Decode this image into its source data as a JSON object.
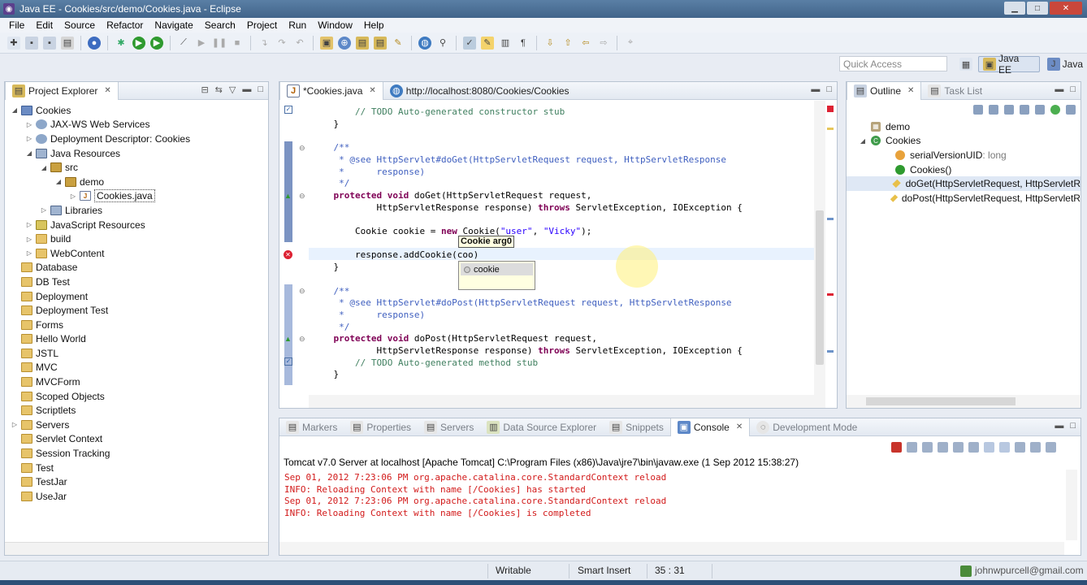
{
  "window": {
    "title": "Java EE - Cookies/src/demo/Cookies.java - Eclipse"
  },
  "menu": [
    "File",
    "Edit",
    "Source",
    "Refactor",
    "Navigate",
    "Search",
    "Project",
    "Run",
    "Window",
    "Help"
  ],
  "toolbar": {
    "quick_access_placeholder": "Quick Access"
  },
  "perspectives": [
    {
      "label": "Java EE",
      "active": true
    },
    {
      "label": "Java",
      "active": false
    }
  ],
  "project_explorer": {
    "title": "Project Explorer",
    "items": [
      {
        "label": "Cookies",
        "level": 0,
        "arrow": "open",
        "icon": "project"
      },
      {
        "label": "JAX-WS Web Services",
        "level": 1,
        "arrow": "closed",
        "icon": "gear"
      },
      {
        "label": "Deployment Descriptor: Cookies",
        "level": 1,
        "arrow": "closed",
        "icon": "gear"
      },
      {
        "label": "Java Resources",
        "level": 1,
        "arrow": "open",
        "icon": "lib"
      },
      {
        "label": "src",
        "level": 2,
        "arrow": "open",
        "icon": "pkg"
      },
      {
        "label": "demo",
        "level": 3,
        "arrow": "open",
        "icon": "pkg"
      },
      {
        "label": "Cookies.java",
        "level": 4,
        "arrow": "closed",
        "icon": "file",
        "selected": true
      },
      {
        "label": "Libraries",
        "level": 2,
        "arrow": "closed",
        "icon": "lib"
      },
      {
        "label": "JavaScript Resources",
        "level": 1,
        "arrow": "closed",
        "icon": "js"
      },
      {
        "label": "build",
        "level": 1,
        "arrow": "closed",
        "icon": "folder"
      },
      {
        "label": "WebContent",
        "level": 1,
        "arrow": "closed",
        "icon": "folder"
      },
      {
        "label": "Database",
        "level": 0,
        "arrow": "",
        "icon": "folder"
      },
      {
        "label": "DB Test",
        "level": 0,
        "arrow": "",
        "icon": "folder"
      },
      {
        "label": "Deployment",
        "level": 0,
        "arrow": "",
        "icon": "folder"
      },
      {
        "label": "Deployment Test",
        "level": 0,
        "arrow": "",
        "icon": "folder"
      },
      {
        "label": "Forms",
        "level": 0,
        "arrow": "",
        "icon": "folder"
      },
      {
        "label": "Hello World",
        "level": 0,
        "arrow": "",
        "icon": "folder"
      },
      {
        "label": "JSTL",
        "level": 0,
        "arrow": "",
        "icon": "folder"
      },
      {
        "label": "MVC",
        "level": 0,
        "arrow": "",
        "icon": "folder"
      },
      {
        "label": "MVCForm",
        "level": 0,
        "arrow": "",
        "icon": "folder"
      },
      {
        "label": "Scoped Objects",
        "level": 0,
        "arrow": "",
        "icon": "folder"
      },
      {
        "label": "Scriptlets",
        "level": 0,
        "arrow": "",
        "icon": "folder"
      },
      {
        "label": "Servers",
        "level": 0,
        "arrow": "closed",
        "icon": "folder"
      },
      {
        "label": "Servlet Context",
        "level": 0,
        "arrow": "",
        "icon": "folder"
      },
      {
        "label": "Session Tracking",
        "level": 0,
        "arrow": "",
        "icon": "folder"
      },
      {
        "label": "Test",
        "level": 0,
        "arrow": "",
        "icon": "folder"
      },
      {
        "label": "TestJar",
        "level": 0,
        "arrow": "",
        "icon": "folder"
      },
      {
        "label": "UseJar",
        "level": 0,
        "arrow": "",
        "icon": "folder"
      }
    ]
  },
  "editor": {
    "tabs": [
      {
        "label": "*Cookies.java",
        "active": true
      },
      {
        "label": "http://localhost:8080/Cookies/Cookies",
        "active": false
      }
    ],
    "code_lines": [
      [
        {
          "t": "        ",
          "c": ""
        },
        {
          "t": "// TODO Auto-generated constructor stub",
          "c": "cm"
        }
      ],
      [
        {
          "t": "    }",
          "c": ""
        }
      ],
      [
        {
          "t": "",
          "c": ""
        }
      ],
      [
        {
          "t": "    /**",
          "c": "jd"
        }
      ],
      [
        {
          "t": "     * @see HttpServlet#doGet(HttpServletRequest request, HttpServletResponse",
          "c": "jd"
        }
      ],
      [
        {
          "t": "     *      response)",
          "c": "jd"
        }
      ],
      [
        {
          "t": "     */",
          "c": "jd"
        }
      ],
      [
        {
          "t": "    ",
          "c": ""
        },
        {
          "t": "protected void",
          "c": "kw"
        },
        {
          "t": " doGet(HttpServletRequest request,",
          "c": ""
        }
      ],
      [
        {
          "t": "            HttpServletResponse response) ",
          "c": ""
        },
        {
          "t": "throws",
          "c": "kw"
        },
        {
          "t": " ServletException, IOException {",
          "c": ""
        }
      ],
      [
        {
          "t": "",
          "c": ""
        }
      ],
      [
        {
          "t": "        Cookie cookie = ",
          "c": ""
        },
        {
          "t": "new",
          "c": "kw"
        },
        {
          "t": " Cookie(",
          "c": ""
        },
        {
          "t": "\"user\"",
          "c": "str"
        },
        {
          "t": ", ",
          "c": ""
        },
        {
          "t": "\"Vicky\"",
          "c": "str"
        },
        {
          "t": ");",
          "c": ""
        }
      ],
      [
        {
          "t": "",
          "c": ""
        }
      ],
      [
        {
          "t": "        response.addCookie(coo)",
          "c": ""
        }
      ],
      [
        {
          "t": "    }",
          "c": ""
        }
      ],
      [
        {
          "t": "",
          "c": ""
        }
      ],
      [
        {
          "t": "    /**",
          "c": "jd"
        }
      ],
      [
        {
          "t": "     * @see HttpServlet#doPost(HttpServletRequest request, HttpServletResponse",
          "c": "jd"
        }
      ],
      [
        {
          "t": "     *      response)",
          "c": "jd"
        }
      ],
      [
        {
          "t": "     */",
          "c": "jd"
        }
      ],
      [
        {
          "t": "    ",
          "c": ""
        },
        {
          "t": "protected void",
          "c": "kw"
        },
        {
          "t": " doPost(HttpServletRequest request,",
          "c": ""
        }
      ],
      [
        {
          "t": "            HttpServletResponse response) ",
          "c": ""
        },
        {
          "t": "throws",
          "c": "kw"
        },
        {
          "t": " ServletException, IOException {",
          "c": ""
        }
      ],
      [
        {
          "t": "        ",
          "c": ""
        },
        {
          "t": "// TODO Auto-generated method stub",
          "c": "cm"
        }
      ],
      [
        {
          "t": "    }",
          "c": ""
        }
      ]
    ],
    "param_hint": "Cookie arg0",
    "proposal": "cookie"
  },
  "outline": {
    "tabs": [
      {
        "label": "Outline",
        "active": true
      },
      {
        "label": "Task List",
        "active": false
      }
    ],
    "items": [
      {
        "label": "demo",
        "suffix": "",
        "icon": "package",
        "level": 0,
        "arrow": ""
      },
      {
        "label": "Cookies",
        "suffix": "",
        "icon": "class",
        "level": 0,
        "arrow": "open"
      },
      {
        "label": "serialVersionUID",
        "suffix": " : long",
        "icon": "field",
        "level": 1,
        "arrow": ""
      },
      {
        "label": "Cookies()",
        "suffix": "",
        "icon": "constructor",
        "level": 1,
        "arrow": ""
      },
      {
        "label": "doGet(HttpServletRequest, HttpServletR",
        "suffix": "",
        "icon": "method",
        "level": 1,
        "arrow": ""
      },
      {
        "label": "doPost(HttpServletRequest, HttpServletR",
        "suffix": "",
        "icon": "method",
        "level": 1,
        "arrow": ""
      }
    ]
  },
  "console": {
    "tabs": [
      {
        "label": "Markers",
        "active": false
      },
      {
        "label": "Properties",
        "active": false
      },
      {
        "label": "Servers",
        "active": false
      },
      {
        "label": "Data Source Explorer",
        "active": false
      },
      {
        "label": "Snippets",
        "active": false
      },
      {
        "label": "Console",
        "active": true
      },
      {
        "label": "Development Mode",
        "active": false
      }
    ],
    "header": "Tomcat v7.0 Server at localhost [Apache Tomcat] C:\\Program Files (x86)\\Java\\jre7\\bin\\javaw.exe (1 Sep 2012 15:38:27)",
    "lines": [
      "Sep 01, 2012 7:23:06 PM org.apache.catalina.core.StandardContext reload",
      "INFO: Reloading Context with name [/Cookies] has started",
      "Sep 01, 2012 7:23:06 PM org.apache.catalina.core.StandardContext reload",
      "INFO: Reloading Context with name [/Cookies] is completed"
    ]
  },
  "status": {
    "writable": "Writable",
    "insert_mode": "Smart Insert",
    "position": "35 : 31",
    "account": "johnwpurcell@gmail.com"
  },
  "colors": {
    "keyword": "#7f0055",
    "comment": "#3f7f5f",
    "javadoc": "#3f5fbf",
    "string": "#2a00ff",
    "console_text": "#d21a1a"
  }
}
